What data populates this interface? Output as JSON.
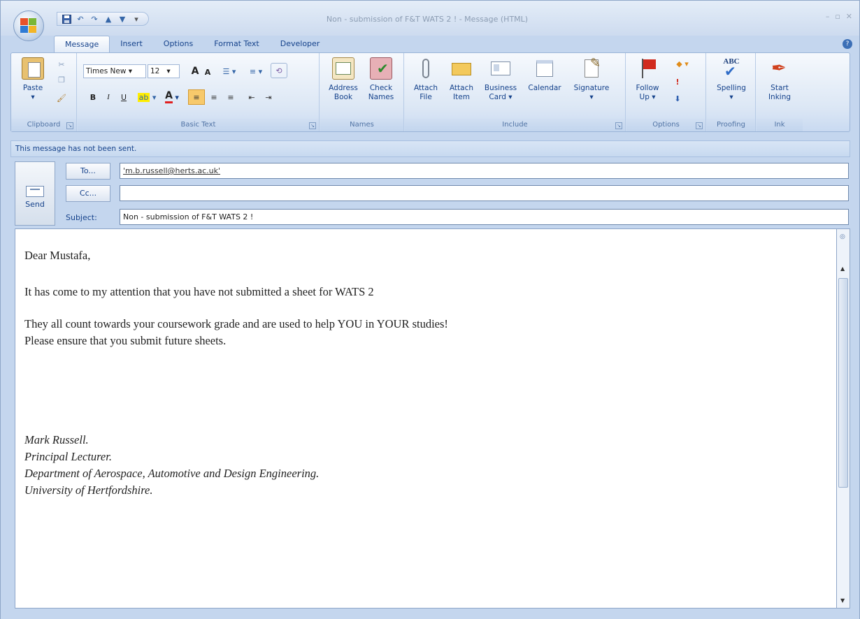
{
  "window": {
    "title": "Non - submission of F&T WATS 2 ! - Message (HTML)"
  },
  "ribbon_tabs": [
    "Message",
    "Insert",
    "Options",
    "Format Text",
    "Developer"
  ],
  "ribbon": {
    "clipboard": {
      "paste": "Paste",
      "group": "Clipboard"
    },
    "basic_text": {
      "font": "Times New",
      "size": "12",
      "bold": "B",
      "italic": "I",
      "underline": "U",
      "font_color": "A",
      "grow": "A",
      "shrink": "A",
      "group": "Basic Text"
    },
    "names": {
      "address_book_1": "Address",
      "address_book_2": "Book",
      "check_names_1": "Check",
      "check_names_2": "Names",
      "group": "Names"
    },
    "include": {
      "attach_file_1": "Attach",
      "attach_file_2": "File",
      "attach_item_1": "Attach",
      "attach_item_2": "Item",
      "business_card_1": "Business",
      "business_card_2": "Card ▾",
      "calendar": "Calendar",
      "signature": "Signature",
      "group": "Include"
    },
    "options": {
      "follow_up_1": "Follow",
      "follow_up_2": "Up ▾",
      "group": "Options"
    },
    "proofing": {
      "spelling_logo": "ABC",
      "spelling": "Spelling",
      "group": "Proofing"
    },
    "ink": {
      "start_1": "Start",
      "start_2": "Inking",
      "group": "Ink"
    }
  },
  "infobar": "This message has not been sent.",
  "header": {
    "send": "Send",
    "to_button": "To...",
    "cc_button": "Cc...",
    "subject_label": "Subject:",
    "to_value": "'m.b.russell@herts.ac.uk'",
    "cc_value": "",
    "subject_value": "Non - submission of F&T WATS 2 !"
  },
  "body": {
    "greeting": "Dear Mustafa,",
    "line1": "It has come to my attention that you have not submitted a sheet for WATS 2",
    "line2": "They all count towards your coursework grade and are used to help YOU in YOUR studies!",
    "line3": "Please ensure that you submit future sheets.",
    "sig1": "Mark Russell.",
    "sig2": "Principal Lecturer.",
    "sig3": "Department of Aerospace, Automotive and Design Engineering.",
    "sig4": "University of Hertfordshire."
  },
  "colors": {
    "accent": "#15428b",
    "frame": "#c4d6ee",
    "flag": "#d12b1e"
  }
}
